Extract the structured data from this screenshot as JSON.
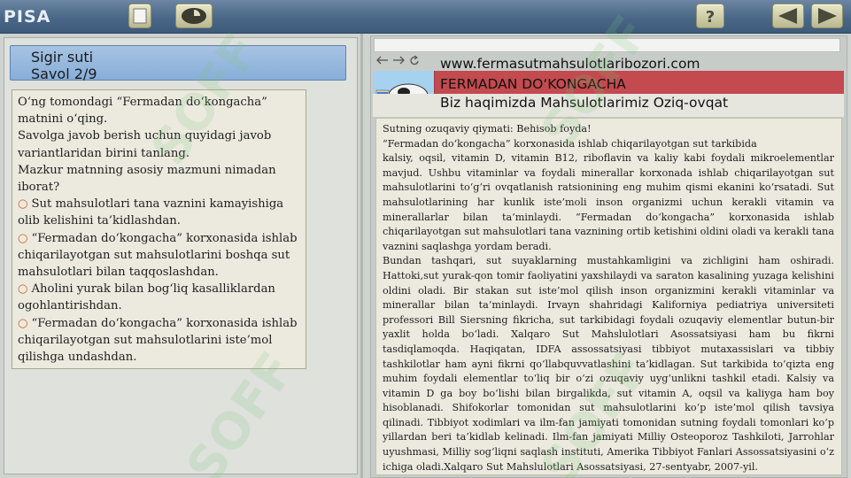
{
  "app": {
    "logo": "PISA"
  },
  "toolbar": {
    "icons": [
      "square-icon",
      "eye-icon",
      "help-icon",
      "back-arrow-icon",
      "forward-arrow-icon"
    ],
    "help_label": "?"
  },
  "question": {
    "unit_title": "Sigir suti",
    "counter": "Savol 2/9",
    "prompt_lines": [
      "O‘ng tomondagi “Fermadan do‘kongacha” matnini o‘qing.",
      "Savolga javob berish uchun quyidagi javob variantlaridan birini tanlang.",
      "Mazkur matnning asosiy mazmuni nimadan iborat?"
    ],
    "options": [
      "Sut mahsulotlari tana vaznini kamayishiga olib kelishini ta’kidlashdan.",
      "“Fermadan do‘kongacha” korxonasida ishlab chiqarilayotgan sut mahsulotlarini boshqa sut mahsulotlari bilan taqqoslashdan.",
      "Aholini yurak bilan bog‘liq kasalliklardan ogohlantirishdan.",
      "“Fermadan do‘kongacha” korxonasida ishlab chiqarilayotgan sut mahsulotlarini iste’mol qilishga undashdan."
    ]
  },
  "browser": {
    "nav_glyphs": "<-->C",
    "url": "www.fermasutmahsulotlaribozori.com",
    "site_title": "FERMADAN DO‘KONGACHA",
    "site_nav": "Biz haqimizda Mahsulotlarimiz Oziq-ovqat"
  },
  "article": {
    "heading": "Sutning ozuqaviy qiymati: Behisob foyda!",
    "subheading": "“Fermadan do‘kongacha” korxonasida ishlab chiqarilayotgan sut tarkibida",
    "paragraph1": "kalsiy, oqsil, vitamin D, vitamin B12, riboflavin va kaliy kabi foydali mikroelementlar mavjud. Ushbu vitaminlar va foydali minerallar korxonada ishlab chiqarilayotgan sut mahsulotlarini to‘g‘ri ovqatlanish ratsionining eng muhim qismi ekanini ko‘rsatadi. Sut mahsulotlarining har kunlik iste’moli inson organizmi uchun kerakli vitamin va minerallarlar bilan ta’minlaydi. “Fermadan do‘kongacha” korxonasida ishlab chiqarilayotgan sut mahsulotlari tana vaznining ortib ketishini oldini oladi va kerakli tana vaznini saqlashga yordam beradi.",
    "paragraph2": "Bundan tashqari, sut suyaklarning mustahkamligini va zichligini ham oshiradi. Hattoki,sut yurak-qon tomir faoliyatini yaxshilaydi va saraton kasalining yuzaga kelishini oldini oladi. Bir stakan sut iste’mol qilish inson organizmini kerakli vitaminlar va minerallar bilan ta’minlaydi. Irvayn shahridagi Kaliforniya pediatriya universiteti professori Bill Siersning fikricha, sut tarkibidagi foydali ozuqaviy elementlar butun-bir yaxlit holda bo‘ladi. Xalqaro Sut Mahslulotlari Asossatsiyasi ham bu fikrni tasdiqlamoqda. Haqiqatan, IDFA assossatsiyasi tibbiyot mutaxassislari va tibbiy tashkilotlar ham ayni fikrni qo‘llabquvvatlashini ta’kidlagan. Sut tarkibida to‘qizta eng muhim foydali elementlar to‘liq bir o‘zi ozuqaviy uyg‘unlikni tashkil etadi. Kalsiy va vitamin D ga boy bo‘lishi bilan birgalikda, sut vitamin A, oqsil va kaliyga ham boy hisoblanadi. Shifokorlar tomonidan sut mahsulotlarini ko‘p iste’mol qilish tavsiya qilinadi. Tibbiyot xodimlari va ilm-fan jamiyati tomonidan sutning foydali tomonlari ko‘p yillardan beri ta’kidlab kelinadi. Ilm-fan jamiyati Milliy Osteoporoz Tashkiloti, Jarrohlar uyushmasi, Milliy sog‘liqni saqlash instituti, Amerika Tibbiyot Fanlari Assossatsiyasini o‘z ichiga oladi.Xalqaro Sut Mahslulotlari Asossatsiyasi, 27-sentyabr, 2007-yil."
  },
  "watermark": "SOFF",
  "colors": {
    "topbar": "#4a6787",
    "question_header": "#98b9de",
    "banner_red": "#c34a4f",
    "option_mark": "#c8642d",
    "paper": "#eceadf"
  }
}
